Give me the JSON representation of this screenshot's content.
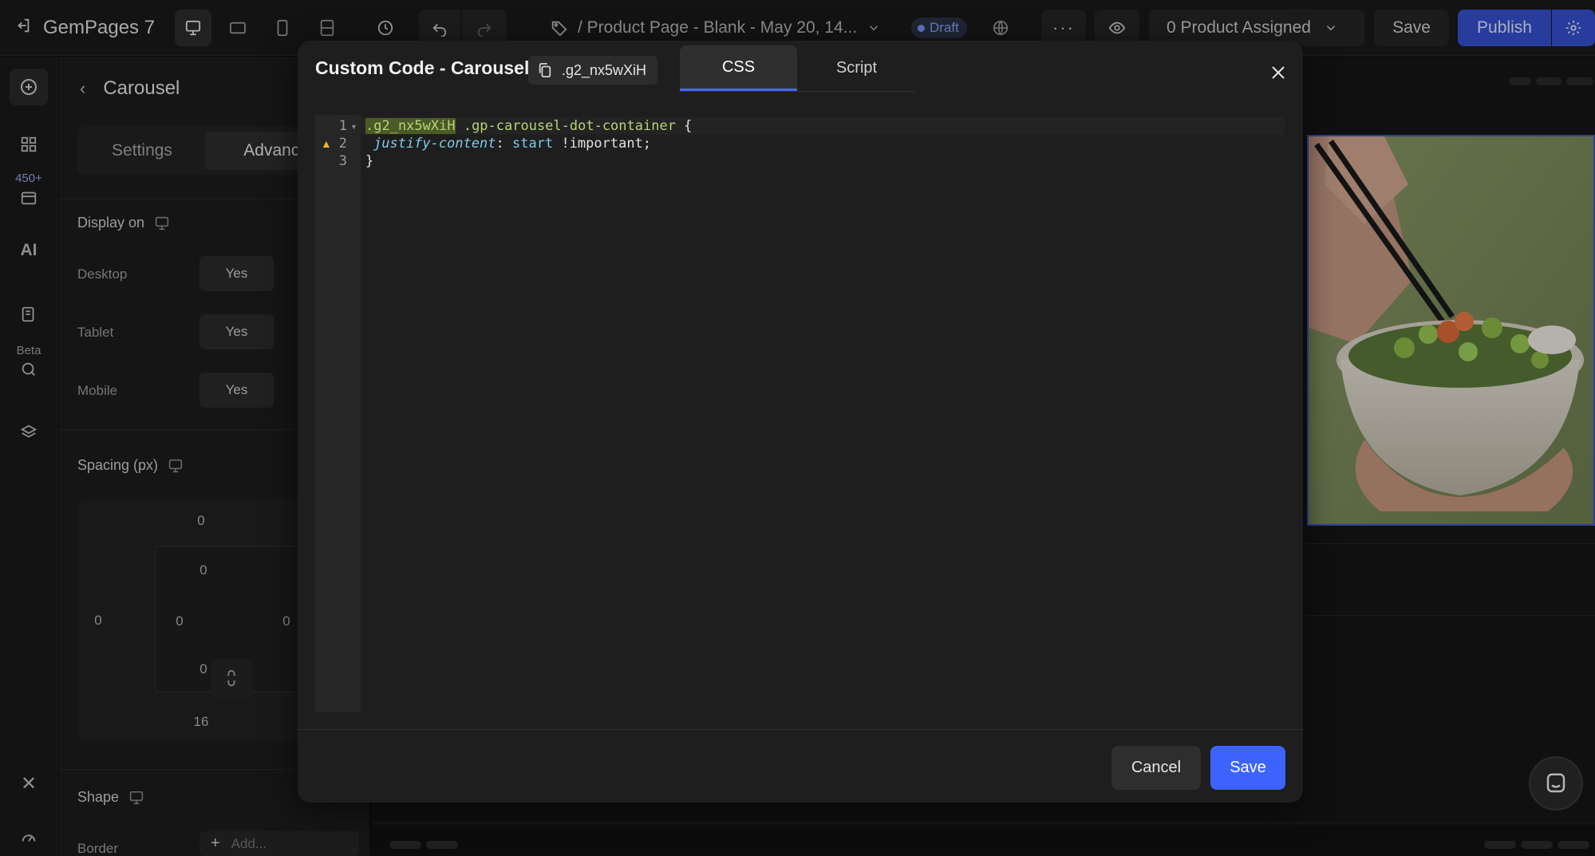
{
  "app": {
    "name": "GemPages 7",
    "page_name": "/ Product Page - Blank - May 20, 14...",
    "status": "Draft",
    "product_assigned": "0 Product Assigned",
    "save_label": "Save",
    "publish_label": "Publish"
  },
  "rail": {
    "badge": "450+",
    "beta": "Beta"
  },
  "panel": {
    "title": "Carousel",
    "tabs": [
      "Settings",
      "Advanced"
    ],
    "display_on": "Display on",
    "rows": [
      {
        "label": "Desktop",
        "value": "Yes"
      },
      {
        "label": "Tablet",
        "value": "Yes"
      },
      {
        "label": "Mobile",
        "value": "Yes"
      }
    ],
    "spacing_label": "Spacing (px)",
    "spacing": {
      "margin_top": "0",
      "margin_left": "0",
      "margin_bottom": "16",
      "padding_top": "0",
      "padding_left": "0",
      "padding_right": "0",
      "padding_bottom": "0"
    },
    "shape_label": "Shape",
    "border_label": "Border",
    "add_placeholder": "Add..."
  },
  "modal": {
    "title": "Custom Code - Carousel",
    "class_chip": ".g2_nx5wXiH",
    "tabs": [
      "CSS",
      "Script"
    ],
    "line_numbers": [
      "1",
      "2",
      "3"
    ],
    "code": {
      "selector": ".g2_nx5wXiH",
      "selector_rest": " .gp-carousel-dot-container ",
      "brace_open": "{",
      "property": "justify-content",
      "colon": ": ",
      "value": "start",
      "important": " !important;",
      "brace_close": "}"
    },
    "cancel_label": "Cancel",
    "save_label": "Save"
  },
  "colors": {
    "accent": "#3d63ff",
    "publish": "#3450d0",
    "warning": "#e8b32e"
  }
}
